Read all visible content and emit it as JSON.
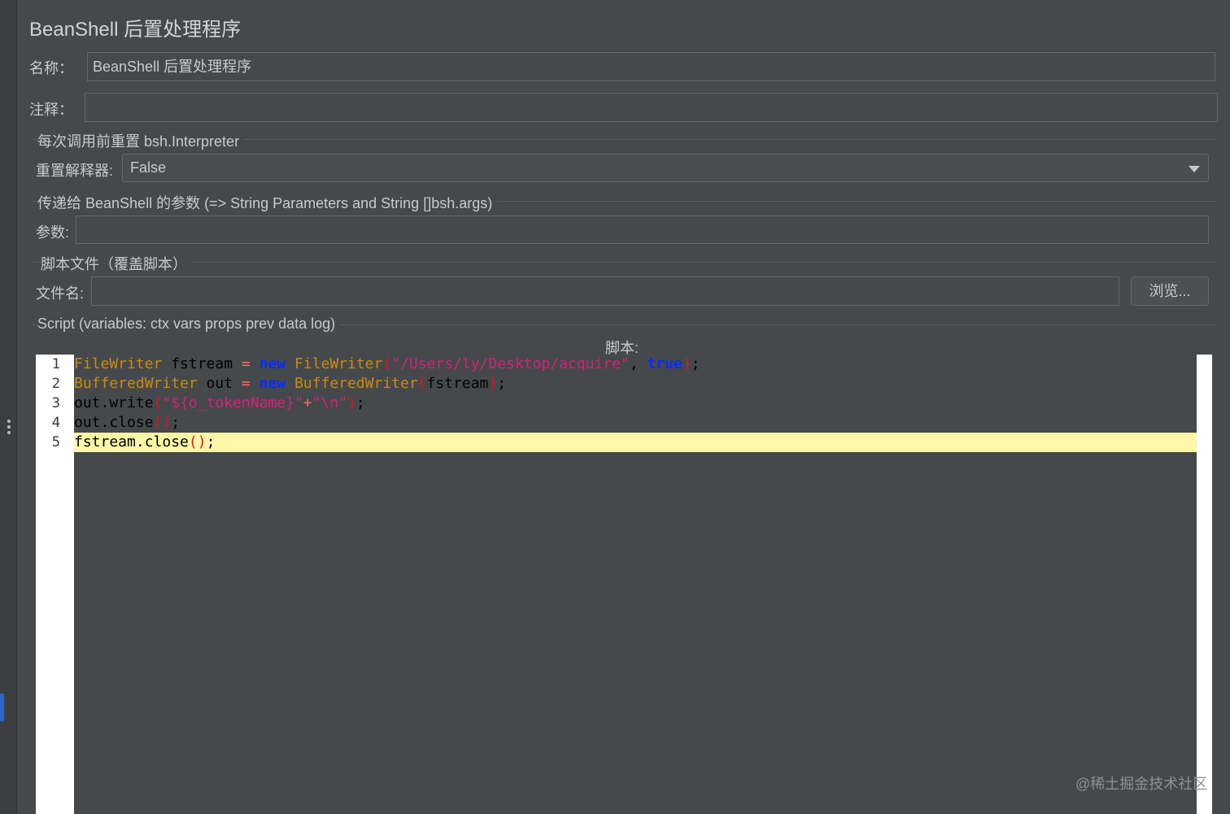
{
  "panel": {
    "title": "BeanShell 后置处理程序"
  },
  "name_field": {
    "label": "名称：",
    "value": "BeanShell 后置处理程序"
  },
  "comment_field": {
    "label": "注释：",
    "value": ""
  },
  "reset_group": {
    "title": "每次调用前重置 bsh.Interpreter",
    "label": "重置解释器:",
    "selected": "False"
  },
  "params_group": {
    "title": "传递给 BeanShell 的参数 (=> String Parameters and String []bsh.args)",
    "label": "参数:",
    "value": ""
  },
  "file_group": {
    "title": "脚本文件（覆盖脚本）",
    "label": "文件名:",
    "value": "",
    "browse_label": "浏览..."
  },
  "script_group": {
    "title": "Script (variables: ctx vars props prev data log)",
    "caption": "脚本:",
    "current_line": 5,
    "lines": [
      {
        "number": "1",
        "tokens": [
          {
            "text": "FileWriter",
            "kind": "type"
          },
          {
            "text": " fstream ",
            "kind": "plain"
          },
          {
            "text": "=",
            "kind": "op"
          },
          {
            "text": " ",
            "kind": "plain"
          },
          {
            "text": "new",
            "kind": "kw"
          },
          {
            "text": " ",
            "kind": "plain"
          },
          {
            "text": "FileWriter",
            "kind": "type"
          },
          {
            "text": "(",
            "kind": "paren"
          },
          {
            "text": "\"/Users/ly/Desktop/acquire\"",
            "kind": "str"
          },
          {
            "text": ", ",
            "kind": "punc"
          },
          {
            "text": "true",
            "kind": "kw"
          },
          {
            "text": ")",
            "kind": "paren"
          },
          {
            "text": ";",
            "kind": "punc"
          }
        ]
      },
      {
        "number": "2",
        "tokens": [
          {
            "text": "BufferedWriter",
            "kind": "type"
          },
          {
            "text": " out ",
            "kind": "plain"
          },
          {
            "text": "=",
            "kind": "op"
          },
          {
            "text": " ",
            "kind": "plain"
          },
          {
            "text": "new",
            "kind": "kw"
          },
          {
            "text": " ",
            "kind": "plain"
          },
          {
            "text": "BufferedWriter",
            "kind": "type"
          },
          {
            "text": "(",
            "kind": "paren"
          },
          {
            "text": "fstream",
            "kind": "plain"
          },
          {
            "text": ")",
            "kind": "paren"
          },
          {
            "text": ";",
            "kind": "punc"
          }
        ]
      },
      {
        "number": "3",
        "tokens": [
          {
            "text": "out.write",
            "kind": "plain"
          },
          {
            "text": "(",
            "kind": "paren"
          },
          {
            "text": "\"${o_tokenName}\"",
            "kind": "str"
          },
          {
            "text": "+",
            "kind": "op"
          },
          {
            "text": "\"\\n\"",
            "kind": "str"
          },
          {
            "text": ")",
            "kind": "paren"
          },
          {
            "text": ";",
            "kind": "punc"
          }
        ]
      },
      {
        "number": "4",
        "tokens": [
          {
            "text": "out.close",
            "kind": "plain"
          },
          {
            "text": "()",
            "kind": "paren"
          },
          {
            "text": ";",
            "kind": "punc"
          }
        ]
      },
      {
        "number": "5",
        "tokens": [
          {
            "text": "fstream.close",
            "kind": "plain"
          },
          {
            "text": "()",
            "kind": "paren"
          },
          {
            "text": ";",
            "kind": "punc"
          }
        ]
      }
    ]
  },
  "watermark": "@稀土掘金技术社区"
}
